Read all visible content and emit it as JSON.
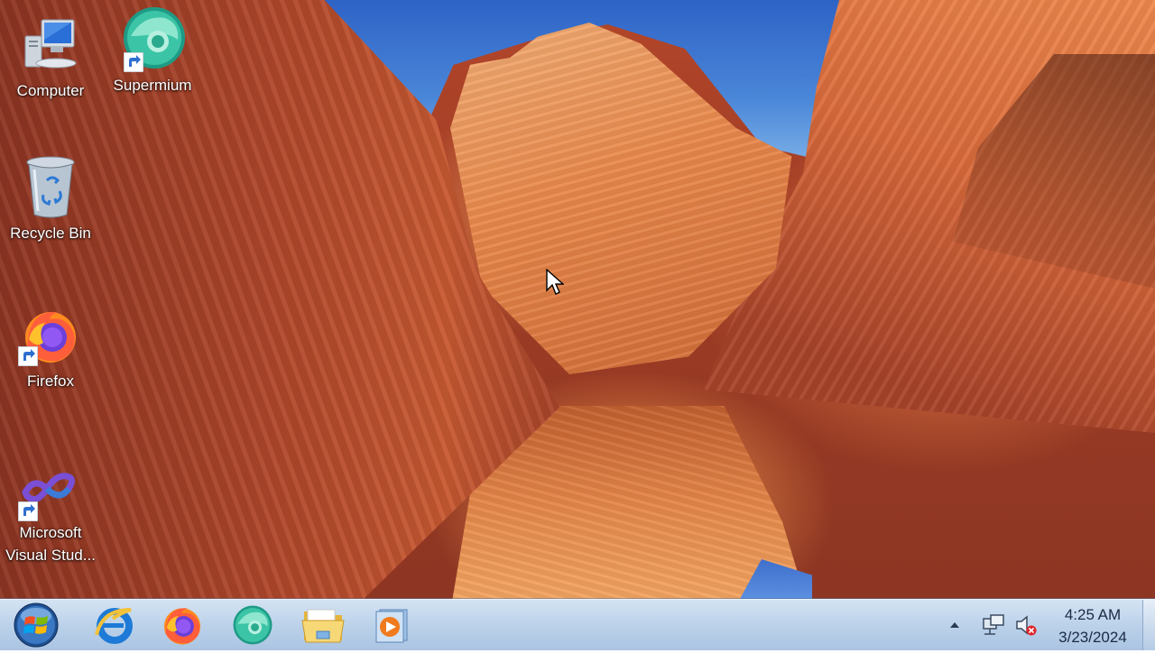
{
  "desktop": {
    "icons": [
      {
        "label": "Computer",
        "icon": "computer-icon",
        "shortcut": false
      },
      {
        "label": "Supermium",
        "icon": "supermium-icon",
        "shortcut": true
      },
      {
        "label": "Recycle Bin",
        "icon": "recycle-bin-icon",
        "shortcut": false
      },
      {
        "label": "Firefox",
        "icon": "firefox-icon",
        "shortcut": true
      },
      {
        "label": "Microsoft Visual Stud...",
        "icon": "visual-studio-icon",
        "shortcut": true
      }
    ]
  },
  "taskbar": {
    "start": {
      "icon": "windows-start-orb"
    },
    "pinned": [
      {
        "icon": "internet-explorer-icon"
      },
      {
        "icon": "firefox-icon"
      },
      {
        "icon": "supermium-icon"
      },
      {
        "icon": "file-explorer-icon"
      },
      {
        "icon": "media-player-icon"
      }
    ],
    "tray": {
      "icons": [
        "show-hidden-icons-arrow",
        "network-icon",
        "volume-muted-icon"
      ],
      "time": "4:25 AM",
      "date": "3/23/2024"
    }
  },
  "colors": {
    "taskbar_top": "#d4e3f3",
    "taskbar_bottom": "#aac4e2",
    "clock_text": "#1b2b44",
    "label_text": "#ffffff"
  }
}
